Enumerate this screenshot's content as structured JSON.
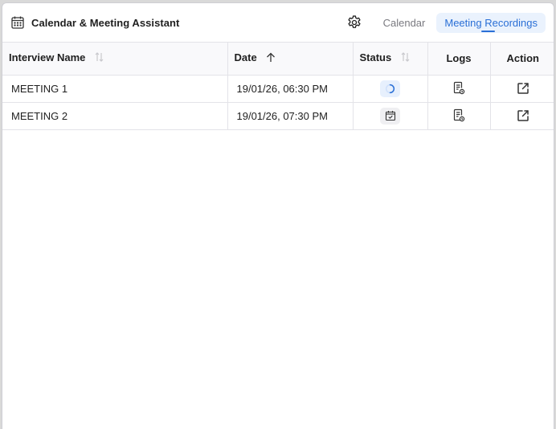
{
  "app": {
    "title": "Calendar & Meeting Assistant",
    "icon": "calendar-icon"
  },
  "tabs": [
    {
      "label": "Calendar",
      "active": false
    },
    {
      "label": "Meeting Recordings",
      "active": true
    }
  ],
  "table": {
    "columns": [
      {
        "label": "Interview Name",
        "sort": "none"
      },
      {
        "label": "Date",
        "sort": "ascending"
      },
      {
        "label": "Status",
        "sort": "none"
      },
      {
        "label": "Logs"
      },
      {
        "label": "Action"
      }
    ],
    "rows": [
      {
        "name": "MEETING 1",
        "date": "19/01/26, 06:30 PM",
        "status": "loading",
        "logs_icon": "log-document-icon",
        "action_icon": "open-external-icon"
      },
      {
        "name": "MEETING 2",
        "date": "19/01/26, 07:30 PM",
        "status": "scheduled",
        "logs_icon": "log-document-icon",
        "action_icon": "open-external-icon"
      }
    ]
  },
  "colors": {
    "accent": "#2a6fd6",
    "accent_bg": "#eaf2fd",
    "border": "#e3e3e8"
  }
}
